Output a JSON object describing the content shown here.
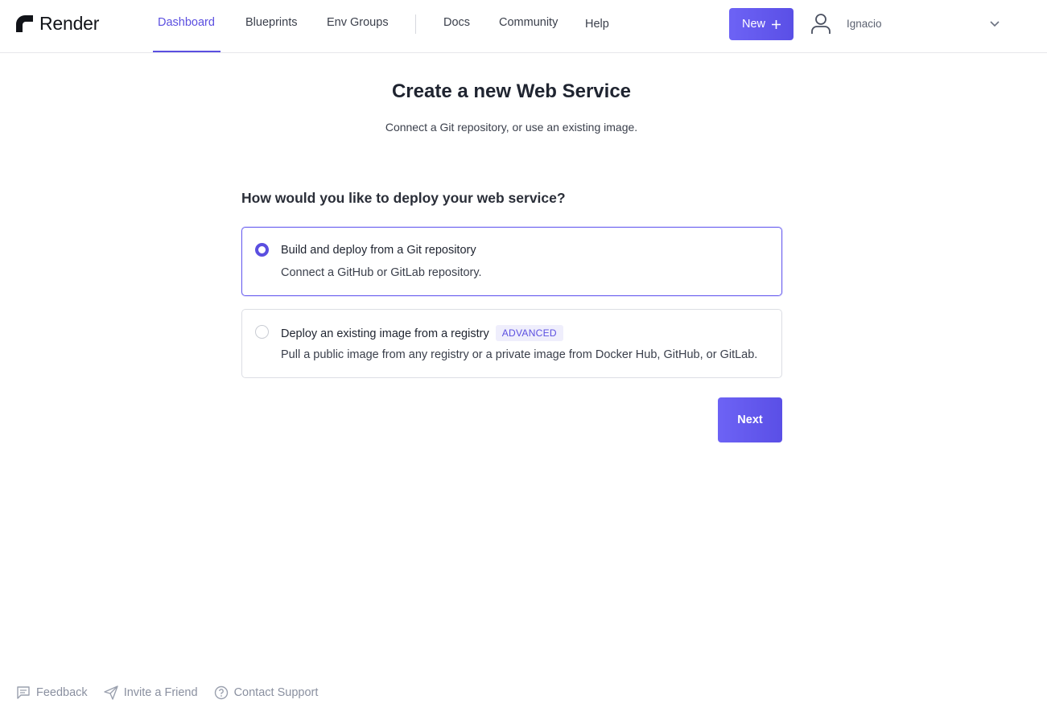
{
  "brand": {
    "name": "Render"
  },
  "nav": {
    "links": [
      {
        "label": "Dashboard",
        "active": true
      },
      {
        "label": "Blueprints"
      },
      {
        "label": "Env Groups"
      },
      {
        "label": "Docs"
      },
      {
        "label": "Community"
      },
      {
        "label": "Help"
      }
    ],
    "new_button_label": "New",
    "user_name": "Ignacio"
  },
  "page": {
    "title_prefix": "Create a new",
    "title_emphasis": "Web Service",
    "subtitle": "Connect a Git repository, or use an existing image."
  },
  "deploy": {
    "question": "How would you like to deploy your web service?",
    "options": [
      {
        "title": "Build and deploy from a Git repository",
        "description": "Connect a GitHub or GitLab repository.",
        "selected": true
      },
      {
        "title": "Deploy an existing image from a registry",
        "badge": "ADVANCED",
        "description": "Pull a public image from any registry or a private image from Docker Hub, GitHub, or GitLab.",
        "selected": false
      }
    ],
    "next_label": "Next"
  },
  "footer": {
    "links": [
      {
        "label": "Feedback",
        "icon": "feedback-icon"
      },
      {
        "label": "Invite a Friend",
        "icon": "send-icon"
      },
      {
        "label": "Contact Support",
        "icon": "help-circle-icon"
      }
    ]
  },
  "colors": {
    "accent": "#5b4fe0",
    "accent_light": "#6d63f5",
    "border": "#dcdee4",
    "muted_text": "#8a90a0"
  }
}
